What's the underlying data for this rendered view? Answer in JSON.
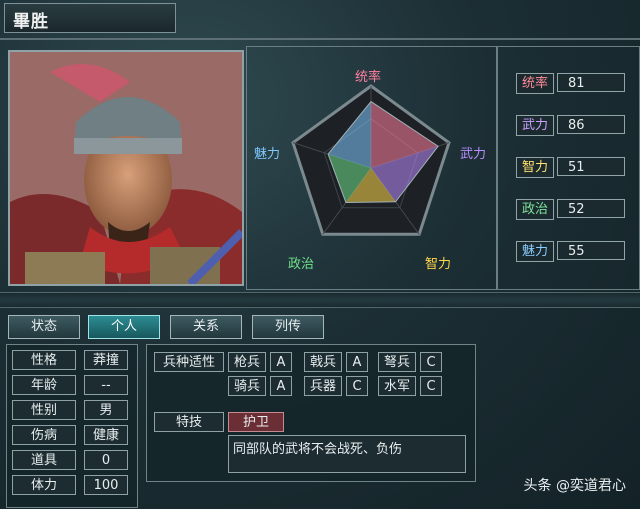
{
  "character": {
    "name": "畢胜"
  },
  "radar": {
    "labels": {
      "top": "统率",
      "right": "武力",
      "bottom_right": "智力",
      "bottom_left": "政治",
      "left": "魅力"
    },
    "values": {
      "统率": 81,
      "武力": 86,
      "智力": 51,
      "政治": 52,
      "魅力": 55
    },
    "colors": {
      "统率": "#ff7f9f",
      "武力": "#b98cff",
      "智力": "#ffd84a",
      "政治": "#6fe08a",
      "魅力": "#7fc8ff"
    }
  },
  "stats": [
    {
      "label": "统率",
      "value": "81",
      "color": "#ff8a9a"
    },
    {
      "label": "武力",
      "value": "86",
      "color": "#c9a0ff"
    },
    {
      "label": "智力",
      "value": "51",
      "color": "#ffe070"
    },
    {
      "label": "政治",
      "value": "52",
      "color": "#7ee29a"
    },
    {
      "label": "魅力",
      "value": "55",
      "color": "#88ccff"
    }
  ],
  "tabs": [
    "状态",
    "个人",
    "关系",
    "列传"
  ],
  "active_tab": "个人",
  "personal": [
    {
      "label": "性格",
      "value": "莽撞"
    },
    {
      "label": "年龄",
      "value": "--"
    },
    {
      "label": "性别",
      "value": "男"
    },
    {
      "label": "伤病",
      "value": "健康"
    },
    {
      "label": "道具",
      "value": "0"
    },
    {
      "label": "体力",
      "value": "100"
    }
  ],
  "aptitude": {
    "header": "兵种适性",
    "row1": [
      {
        "name": "枪兵",
        "grade": "A"
      },
      {
        "name": "戟兵",
        "grade": "A"
      },
      {
        "name": "弩兵",
        "grade": "C"
      }
    ],
    "row2": [
      {
        "name": "骑兵",
        "grade": "A"
      },
      {
        "name": "兵器",
        "grade": "C"
      },
      {
        "name": "水军",
        "grade": "C"
      }
    ]
  },
  "skill": {
    "header": "特技",
    "name": "护卫",
    "description": "同部队的武将不会战死、负伤"
  },
  "watermark": "头条 @奕道君心"
}
